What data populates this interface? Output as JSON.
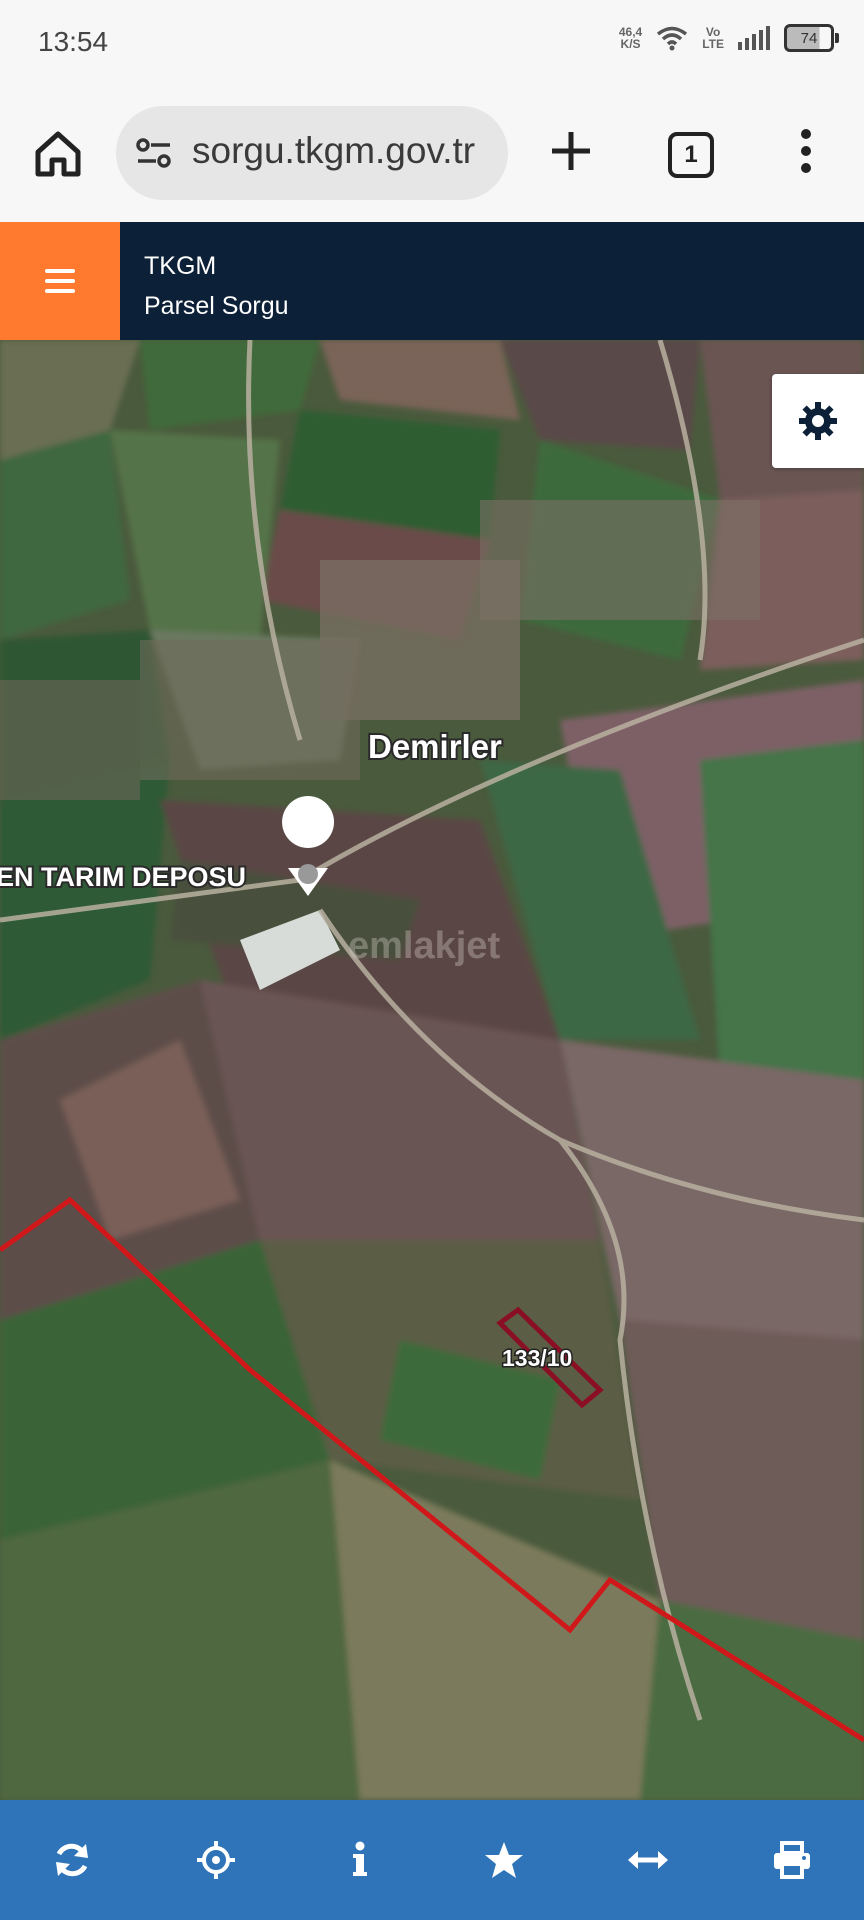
{
  "status_bar": {
    "time": "13:54",
    "speed_value": "46,4",
    "speed_unit": "K/S",
    "volte_top": "Vo",
    "volte_bottom": "LTE",
    "battery": "74",
    "icons": [
      "wifi-icon",
      "signal-icon",
      "battery-icon"
    ]
  },
  "browser": {
    "url": "sorgu.tkgm.gov.tr",
    "tab_count": "1",
    "icons": [
      "home-icon",
      "site-settings-icon",
      "new-tab-icon",
      "tab-switcher-icon",
      "more-menu-icon"
    ]
  },
  "app_header": {
    "title": "TKGM",
    "subtitle": "Parsel Sorgu",
    "accent_color": "#ff7a2e",
    "header_color": "#0c2037"
  },
  "map": {
    "place_label": "Demirler",
    "poi_label": "EN TARIM DEPOSU",
    "parcel_label": "133/10",
    "watermark": "emlakjet",
    "boundary_color": "#d0181b",
    "parcel_color": "#8a0f24"
  },
  "toolbar": {
    "color": "#2f74b8",
    "buttons": [
      "refresh-icon",
      "locate-icon",
      "info-icon",
      "star-icon",
      "measure-icon",
      "print-icon"
    ]
  }
}
